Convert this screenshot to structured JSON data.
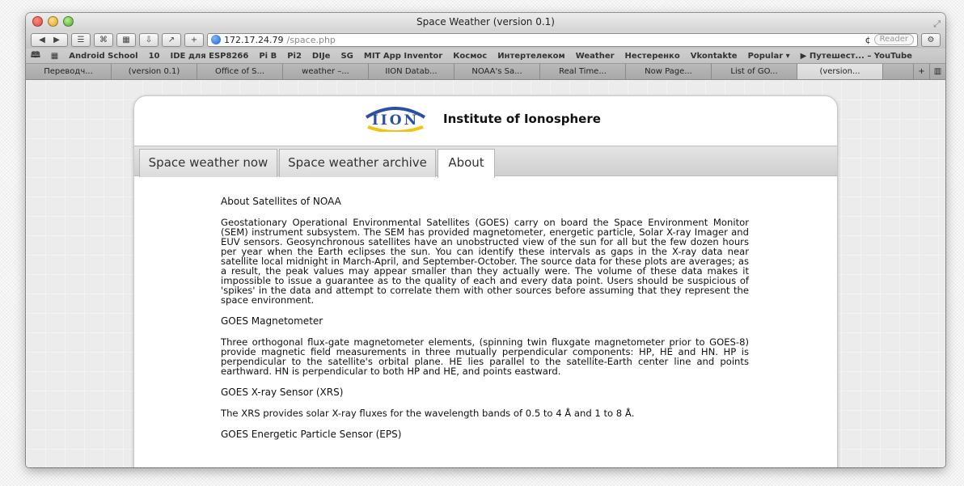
{
  "window": {
    "title": "Space Weather (version 0.1)"
  },
  "toolbar": {
    "url_host": "172.17.24.79",
    "url_path": "/space.php",
    "reader_label": "Reader",
    "reload_glyph": "¢",
    "plus_glyph": "+"
  },
  "bookmarks": [
    "Android School",
    "10",
    "IDE для ESP8266",
    "Pi B",
    "Pi2",
    "DIJe",
    "SG",
    "MIT App Inventor",
    "Космос",
    "Интертелеком",
    "Weather",
    "Нестеренко",
    "Vkontakte",
    "Popular ▾",
    "▶ Путешест... – YouTube"
  ],
  "browser_tabs": [
    "Переводч...",
    "(version 0.1)",
    "Office of S...",
    "weather –...",
    "IION Datab...",
    "NOAA's Sa...",
    "Real Time...",
    "Now Page...",
    "List of GO...",
    "(version..."
  ],
  "site": {
    "logo_text": "IION",
    "title": "Institute of Ionosphere",
    "nav": [
      "Space weather now",
      "Space weather archive",
      "About"
    ]
  },
  "article": {
    "heading1": "About Satellites of NOAA",
    "para1": "Geostationary Operational Environmental Satellites (GOES) carry on board the Space Environment Monitor (SEM) instrument subsystem. The SEM has provided magnetometer, energetic particle, Solar X-ray Imager and EUV sensors. Geosynchronous satellites have an unobstructed view of the sun for all but the few dozen hours per year when the Earth eclipses the sun. You can identify these intervals as gaps in the X-ray data near satellite local midnight in March-April, and September-October. The source data for these plots are averages; as a result, the peak values may appear smaller than they actually were. The volume of these data makes it impossible to issue a guarantee as to the quality of each and every data point. Users should be suspicious of 'spikes' in the data and attempt to correlate them with other sources before assuming that they represent the space environment.",
    "heading2": "GOES Magnetometer",
    "para2": "Three orthogonal flux-gate magnetometer elements, (spinning twin fluxgate magnetometer prior to GOES-8) provide magnetic field measurements in three mutually perpendicular components: HP, HE and HN. HP is perpendicular to the satellite's orbital plane. HE lies parallel to the satellite-Earth center line and points earthward. HN is perpendicular to both HP and HE, and points eastward.",
    "heading3": "GOES X-ray Sensor (XRS)",
    "para3": "The XRS provides solar X-ray fluxes for the wavelength bands of 0.5 to 4 Å and 1 to 8 Å.",
    "heading4": "GOES Energetic Particle Sensor (EPS)"
  },
  "colors": {
    "logo_blue": "#2a4fa3",
    "logo_yellow": "#f2c40f"
  }
}
